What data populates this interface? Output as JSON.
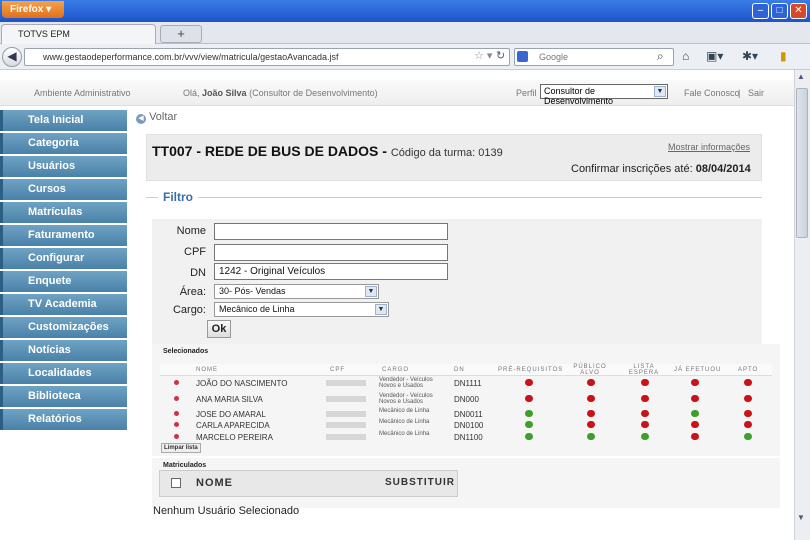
{
  "browser": {
    "menu_label": "Firefox",
    "tab_title": "TOTVS EPM",
    "new_tab": "+",
    "url": "www.gestaodeperformance.com.br/vvv/view/matricula/gestaoAvancada.jsf",
    "search_placeholder": "Google"
  },
  "header": {
    "area_label": "Ambiente Administrativo",
    "greeting_prefix": "Olá,",
    "user_name": "João Silva",
    "user_role": "(Consultor de Desenvolvimento)",
    "perfil_label": "Perfil",
    "perfil_value": "Consultor de Desenvolvimento",
    "fale_conosco": "Fale Conosco",
    "separator": "|",
    "sair": "Sair"
  },
  "sidebar": {
    "items": [
      "Tela Inicial",
      "Categoria",
      "Usuários",
      "Cursos",
      "Matrículas",
      "Faturamento",
      "Configurar",
      "Enquete",
      "TV Academia",
      "Customizações",
      "Notícias",
      "Localidades",
      "Biblioteca",
      "Relatórios"
    ]
  },
  "voltar": "Voltar",
  "course": {
    "title": "TT007 - REDE DE BUS DE DADOS - ",
    "codigo": "Código da turma: 0139",
    "mostrar": "Mostrar informações",
    "confirmar_label": "Confirmar inscrições até: ",
    "confirmar_date": "08/04/2014"
  },
  "filter": {
    "heading": "Filtro",
    "nome_label": "Nome",
    "nome_value": "",
    "cpf_label": "CPF",
    "cpf_value": "",
    "dn_label": "DN",
    "dn_value": "1242 - Original Veículos",
    "area_label": "Área:",
    "area_value": "30- Pós- Vendas",
    "cargo_label": "Cargo:",
    "cargo_value": "Mecânico de Linha",
    "ok_label": "Ok"
  },
  "selecionados": {
    "heading": "Selecionados",
    "columns": [
      "NOME",
      "CPF",
      "CARGO",
      "DN",
      "PRÉ-REQUISITOS",
      "PÚBLICO ALVO",
      "LISTA ESPERA",
      "JÁ EFETUOU",
      "APTO"
    ],
    "rows": [
      {
        "nome": "JOÃO DO NASCIMENTO",
        "cargo": "Vendedor - Veículos Novos e Usados",
        "dn": "DN1111",
        "status": [
          "red",
          "red",
          "red",
          "red",
          "red"
        ]
      },
      {
        "nome": "ANA MARIA SILVA",
        "cargo": "Vendedor - Veículos Novos e Usados",
        "dn": "DN000",
        "status": [
          "red",
          "red",
          "red",
          "red",
          "red"
        ]
      },
      {
        "nome": "JOSE DO AMARAL",
        "cargo": "Mecânico de Linha",
        "dn": "DN0011",
        "status": [
          "green",
          "red",
          "red",
          "green",
          "red"
        ]
      },
      {
        "nome": "CARLA APARECIDA",
        "cargo": "Mecânico de Linha",
        "dn": "DN0100",
        "status": [
          "green",
          "red",
          "red",
          "red",
          "red"
        ]
      },
      {
        "nome": "MARCELO PEREIRA",
        "cargo": "Mecânico de Linha",
        "dn": "DN1100",
        "status": [
          "green",
          "green",
          "green",
          "red",
          "green"
        ]
      }
    ],
    "limpar": "Limpar lista"
  },
  "matriculados": {
    "heading": "Matriculados",
    "col_nome": "NOME",
    "col_substituir": "SUBSTITUIR",
    "empty": "Nenhum Usuário Selecionado"
  }
}
